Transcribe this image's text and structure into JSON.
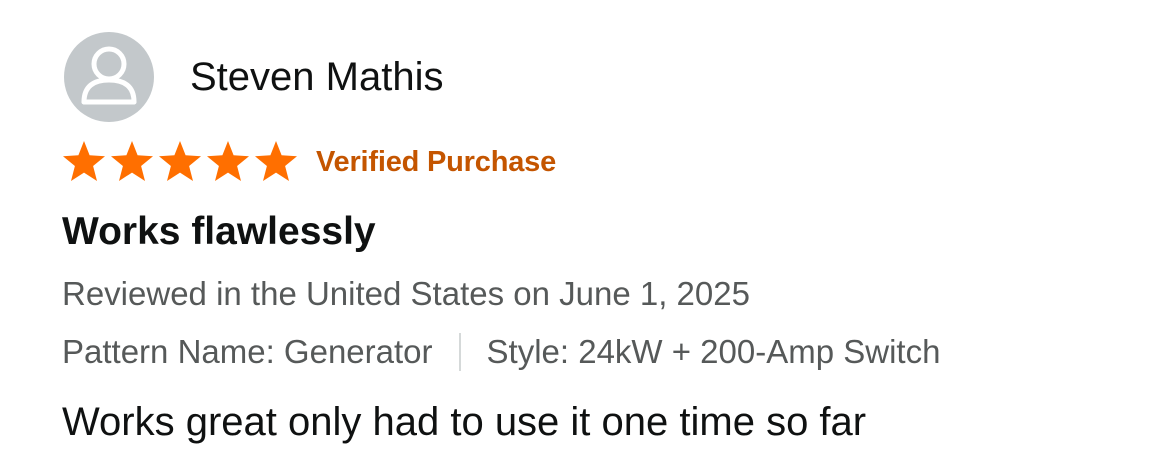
{
  "reviewer": {
    "name": "Steven Mathis",
    "avatar_icon": "default-user-avatar-icon",
    "avatar_color": "#c3c8cb"
  },
  "rating": {
    "stars": 5,
    "max": 5,
    "star_color": "#ff6f00",
    "star_icon": "star-icon"
  },
  "verified_label": "Verified Purchase",
  "verified_color": "#c45500",
  "title": "Works flawlessly",
  "date_text": "Reviewed in the United States on June 1, 2025",
  "variant": {
    "pattern": "Pattern Name: Generator",
    "style": "Style: 24kW + 200-Amp Switch"
  },
  "body": "Works great only had to use it one time so far"
}
